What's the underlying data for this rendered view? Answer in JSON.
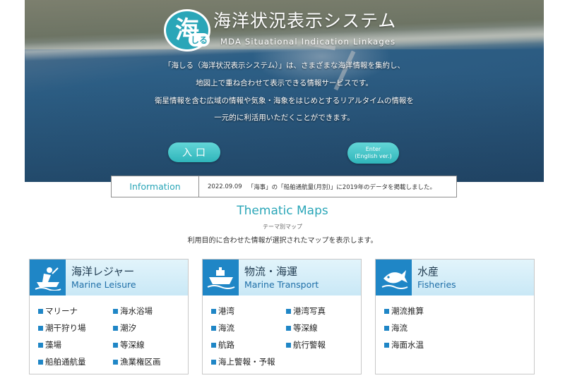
{
  "hero": {
    "logo_kanji": "海",
    "logo_kana": "しる",
    "title": "海洋状況表示システム",
    "subtitle": "MDA Situational Indication Linkages",
    "intro_lines": [
      "「海しる（海洋状況表示システム）」は、さまざまな海洋情報を集約し、",
      "地図上で重ね合わせて表示できる情報サービスです。",
      "衛星情報を含む広域の情報や気象・海象をはじめとするリアルタイムの情報を",
      "一元的に利活用いただくことができます。"
    ],
    "enter_label": "入口",
    "english_line1": "Enter",
    "english_line2": "(English ver.)"
  },
  "info": {
    "label": "Information",
    "date": "2022.09.09",
    "text": "「海事」の「船舶通航量(月別)」に2019年のデータを掲載しました。"
  },
  "thematic": {
    "title": "Thematic Maps",
    "subtitle": "テーマ別マップ",
    "description": "利用目的に合わせた情報が選択されたマップを表示します。"
  },
  "cards": [
    {
      "icon": "boat-person-icon",
      "title_jp": "海洋レジャー",
      "title_en": "Marine Leisure",
      "items": [
        "マリーナ",
        "海水浴場",
        "潮干狩り場",
        "潮汐",
        "藻場",
        "等深線",
        "船舶通航量",
        "漁業権区画"
      ]
    },
    {
      "icon": "ship-icon",
      "title_jp": "物流・海運",
      "title_en": "Marine Transport",
      "items": [
        "港湾",
        "港湾写真",
        "海流",
        "等深線",
        "航路",
        "航行警報",
        "海上警報・予報"
      ]
    },
    {
      "icon": "fish-icon",
      "title_jp": "水産",
      "title_en": "Fisheries",
      "items": [
        "潮流推算",
        "海流",
        "海面水温"
      ]
    }
  ],
  "colors": {
    "accent": "#2aa6b8",
    "card_icon_bg": "#1f86c6",
    "card_head": "#d6eef9"
  }
}
